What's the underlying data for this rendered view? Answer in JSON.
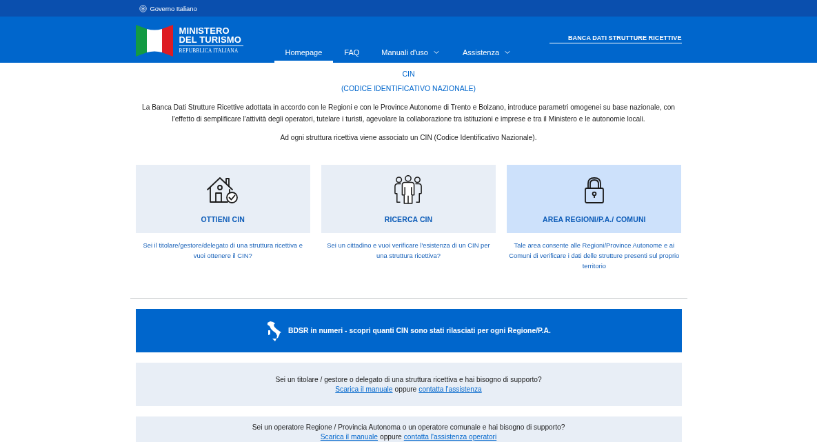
{
  "top_bar": {
    "label": "Governo Italiano"
  },
  "header": {
    "brand": {
      "lines": [
        "MINISTERO",
        "DEL TURISMO"
      ],
      "subtitle": "REPUBBLICA ITALIANA"
    },
    "nav": [
      {
        "label": "Homepage",
        "selected": true,
        "dropdown": false
      },
      {
        "label": "FAQ",
        "selected": false,
        "dropdown": false
      },
      {
        "label": "Manuali d'uso",
        "selected": false,
        "dropdown": true
      },
      {
        "label": "Assistenza",
        "selected": false,
        "dropdown": true
      }
    ],
    "site_link": "BANCA DATI STRUTTURE RICETTIVE"
  },
  "intro": {
    "title": "CIN",
    "subtitle": "(CODICE IDENTIFICATIVO NAZIONALE)",
    "paragraphs": [
      "La Banca Dati Strutture Ricettive adottata in accordo con le Regioni e con le Province Autonome di Trento e Bolzano, introduce parametri omogenei su base nazionale, con l'effetto di semplificare l'attività degli operatori, tutelare i turisti, agevolare la collaborazione tra istituzioni e imprese e tra il Ministero e le autonomie locali.",
      "Ad ogni struttura ricettiva viene associato un CIN (Codice Identificativo Nazionale)."
    ]
  },
  "cards": [
    {
      "kind": "house",
      "title": "OTTIENI CIN",
      "description": "Sei il titolare/gestore/delegato di una struttura ricettiva e vuoi ottenere il CIN?",
      "highlighted": false
    },
    {
      "kind": "people",
      "title": "RICERCA CIN",
      "description": "Sei un cittadino e vuoi verificare l'esistenza di un CIN per una struttura ricettiva?",
      "highlighted": false
    },
    {
      "kind": "lock",
      "title": "AREA REGIONI/P.A./ COMUNI",
      "description": "Tale area consente alle Regioni/Province Autonome e ai Comuni di verificare i dati delle strutture presenti sul proprio territorio",
      "highlighted": true
    }
  ],
  "banner": {
    "text": "BDSR in numeri - scopri quanti CIN sono stati rilasciati per ogni Regione/P.A."
  },
  "support_boxes": [
    {
      "question": "Sei un titolare / gestore o delegato di una struttura ricettiva e hai bisogno di supporto?",
      "manual_link": "Scarica il manuale",
      "connector": "oppure",
      "contact_link": "contatta l'assistenza"
    },
    {
      "question": "Sei un operatore Regione / Provincia Autonoma o un operatore comunale e hai bisogno di supporto?",
      "manual_link": "Scarica il manuale",
      "connector": "oppure",
      "contact_link": "contatta l'assistenza operatori"
    }
  ]
}
